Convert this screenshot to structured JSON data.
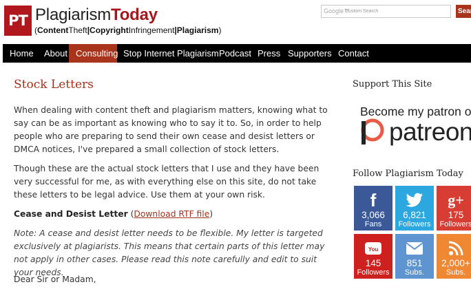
{
  "header": {
    "logo_initials": "PT",
    "title_plain": "Plagiarism",
    "title_bold": "Today",
    "tagline_open": "(",
    "tagline_1_bold": "Content",
    "tagline_1": "Theft",
    "tagline_sep": "|",
    "tagline_2_bold": "Copyright",
    "tagline_2": "Infringement",
    "tagline_3_bold": "Plagiarism",
    "tagline_close": ")"
  },
  "search": {
    "google_label": "Google™",
    "placeholder": "Custom Search",
    "button_label": "Search"
  },
  "nav": {
    "items": [
      {
        "label": "Home"
      },
      {
        "label": "About"
      },
      {
        "label": "Consulting",
        "active": true
      },
      {
        "label": "Stop Internet Plagiarism"
      },
      {
        "label": "Podcast"
      },
      {
        "label": "Press"
      },
      {
        "label": "Supporters"
      },
      {
        "label": "Contact"
      }
    ],
    "active_color": "#a8341c"
  },
  "main": {
    "title": "Stock Letters",
    "para1": "When dealing with content theft and plagiarism matters, knowing what to say can be as important as knowing who to say it to. So, in order to help people who are preparing to send their own cease and desist letters or DMCA notices, I've prepared a small collection of stock letters.",
    "para2": "Though these are the actual stock letters that I use and they have been very successful for me, as with everything else on this site, do not take these letters to be legal advice. Use them at your own risk.",
    "section_heading": "Cease and Desist Letter",
    "download_open": "(",
    "download_link": "Download RTF file",
    "download_close": ")",
    "note": "Note: A cease and desist letter needs to be flexible. My letter is targeted exclusively at plagiarists. This means that certain parts of this letter may not apply in other cases. Please read this note carefully and edit to suit your needs.",
    "salutation": "Dear Sir or Madam,"
  },
  "sidebar": {
    "support_title": "Support This Site",
    "patreon_tagline": "Become my patron on",
    "patreon_word": "patreon",
    "follow_title": "Follow Plagiarism Today",
    "tiles": [
      {
        "icon": "facebook-icon",
        "glyph": "f",
        "count": "3,066",
        "label": "Fans",
        "color": "#3b5998"
      },
      {
        "icon": "twitter-icon",
        "glyph": "🐦",
        "count": "6,821",
        "label": "Followers",
        "color": "#2ca7e0"
      },
      {
        "icon": "google-plus-icon",
        "glyph": "g+",
        "count": "175",
        "label": "Followers",
        "color": "#d73d32"
      },
      {
        "icon": "youtube-icon",
        "glyph": "You",
        "count": "145",
        "label": "Followers",
        "color": "#cd201f"
      },
      {
        "icon": "email-icon",
        "glyph": "✉",
        "count": "851",
        "label": "Subs.",
        "color": "#5e95d0"
      },
      {
        "icon": "rss-icon",
        "glyph": "◥",
        "count": "2,000+",
        "label": "Subs.",
        "color": "#ef8733"
      }
    ]
  },
  "colors": {
    "brand_red": "#b0181e",
    "accent": "#a4311a"
  }
}
